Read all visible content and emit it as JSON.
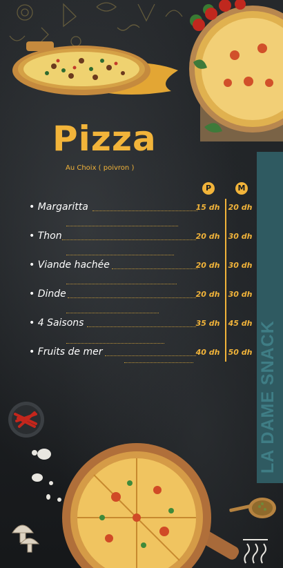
{
  "title": "Pizza",
  "subtitle": "Au Choix ( poivron )",
  "sizes": {
    "p": "P",
    "m": "M"
  },
  "brand": "LA DAME SNACK",
  "menu": [
    {
      "name": "Margaritta",
      "p": "15 dh",
      "m": "20 dh"
    },
    {
      "name": "Thon",
      "p": "20 dh",
      "m": "30 dh"
    },
    {
      "name": "Viande hachée",
      "p": "20 dh",
      "m": "30 dh"
    },
    {
      "name": "Dinde",
      "p": "20 dh",
      "m": "30 dh"
    },
    {
      "name": "4 Saisons",
      "p": "35 dh",
      "m": "45 dh"
    },
    {
      "name": "Fruits de mer",
      "p": "40 dh",
      "m": "50 dh"
    }
  ],
  "colors": {
    "accent": "#f2b43a",
    "background": "#1c1f22",
    "brand": "#3f7d85",
    "band": "#2f5a61"
  },
  "icons": [
    "pizza-icon",
    "tomato-icon",
    "chili-icon",
    "mushroom-icon",
    "spoon-icon"
  ]
}
